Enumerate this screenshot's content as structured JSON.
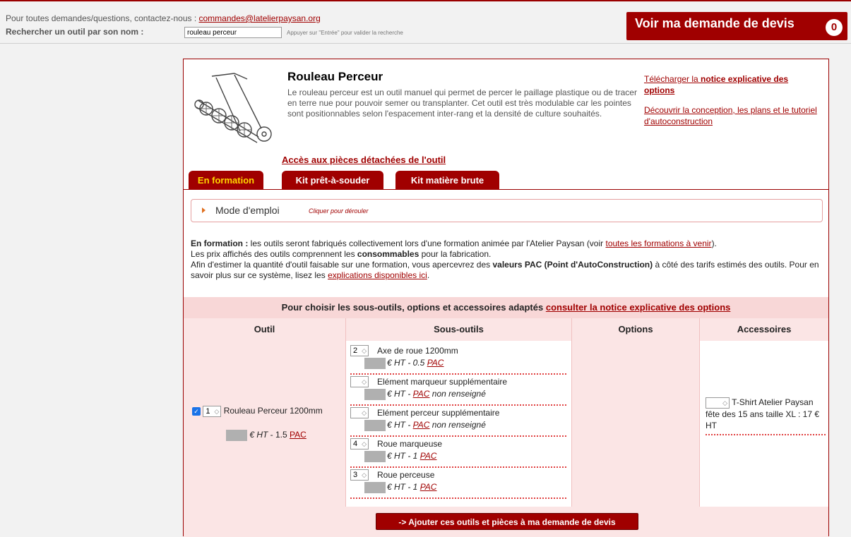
{
  "header": {
    "contact_prefix": "Pour toutes demandes/questions, contactez-nous : ",
    "contact_email": "commandes@latelierpaysan.org",
    "search_label": "Rechercher un outil par son nom :",
    "search_value": "rouleau perceur",
    "search_hint": "Appuyer sur \"Entrée\" pour valider la recherche",
    "quote_button": "Voir ma demande de devis",
    "quote_count": "0"
  },
  "tool": {
    "title": "Rouleau Perceur",
    "description": "Le rouleau perceur est un outil manuel qui permet de percer le paillage plastique ou de tracer en terre nue pour pouvoir semer ou transplanter. Cet outil est très modulable car les pointes sont positionnables selon l'espacement inter-rang et la densité de culture souhaités.",
    "link_notice_a": "Télécharger la ",
    "link_notice_b": "notice explicative des options",
    "link_conception": "Découvrir la conception, les plans et le tutoriel d'autoconstruction",
    "spare_parts_link": "Accès aux pièces détachées de l'outil"
  },
  "tabs": [
    {
      "label": "En formation",
      "active": true
    },
    {
      "label": "Kit prêt-à-souder",
      "active": false
    },
    {
      "label": "Kit matière brute",
      "active": false
    }
  ],
  "mode": {
    "title": "Mode d'emploi",
    "hint": "Cliquer pour dérouler"
  },
  "formation": {
    "lead": "En formation :",
    "line1_a": " les outils seront fabriqués collectivement lors d'une formation animée par l'Atelier Paysan (voir ",
    "line1_link": "toutes les formations à venir",
    "line1_b": ").",
    "line2_a": "Les prix affichés des outils comprennent les ",
    "line2_bold": "consommables",
    "line2_b": " pour la fabrication.",
    "line3_a": "Afin d'estimer la quantité d'outil faisable sur une formation, vous apercevrez des ",
    "line3_bold": "valeurs PAC (Point d'AutoConstruction)",
    "line3_b": " à côté des tarifs estimés des outils. Pour en savoir plus sur ce système, lisez les ",
    "line3_link": "explications disponibles ici",
    "line3_c": "."
  },
  "options_table": {
    "header_text": "Pour choisir les sous-outils, options et accessoires adaptés ",
    "header_link": "consulter la notice explicative des options",
    "columns": [
      "Outil",
      "Sous-outils",
      "Options",
      "Accessoires"
    ],
    "outil": {
      "checked": true,
      "qty": "1",
      "name": "Rouleau Perceur 1200mm",
      "price_suffix": " € HT",
      "pac": " - 1.5 ",
      "pac_link": "PAC"
    },
    "sub_tools": [
      {
        "qty": "2",
        "name": "Axe de roue 1200mm",
        "price": "€ HT - 0.5 ",
        "pac_link": "PAC",
        "pac_tail": ""
      },
      {
        "qty": "",
        "name": "Elément marqueur supplémentaire",
        "price": "€ HT - ",
        "pac_link": "PAC",
        "pac_tail": " non renseigné"
      },
      {
        "qty": "",
        "name": "Elément perceur supplémentaire",
        "price": "€ HT - ",
        "pac_link": "PAC",
        "pac_tail": " non renseigné"
      },
      {
        "qty": "4",
        "name": "Roue marqueuse",
        "price": "€ HT - 1 ",
        "pac_link": "PAC",
        "pac_tail": ""
      },
      {
        "qty": "3",
        "name": "Roue perceuse",
        "price": "€ HT - 1 ",
        "pac_link": "PAC",
        "pac_tail": ""
      }
    ],
    "accessory": {
      "qty": "",
      "name": "T-Shirt Atelier Paysan fête des 15 ans taille XL : 17 € HT"
    },
    "add_button": "-> Ajouter ces outils et pièces à ma demande de devis"
  },
  "colors": {
    "brand_red": "#a00000",
    "active_tab_text": "#ffd700",
    "table_bg": "#fbe5e5"
  }
}
